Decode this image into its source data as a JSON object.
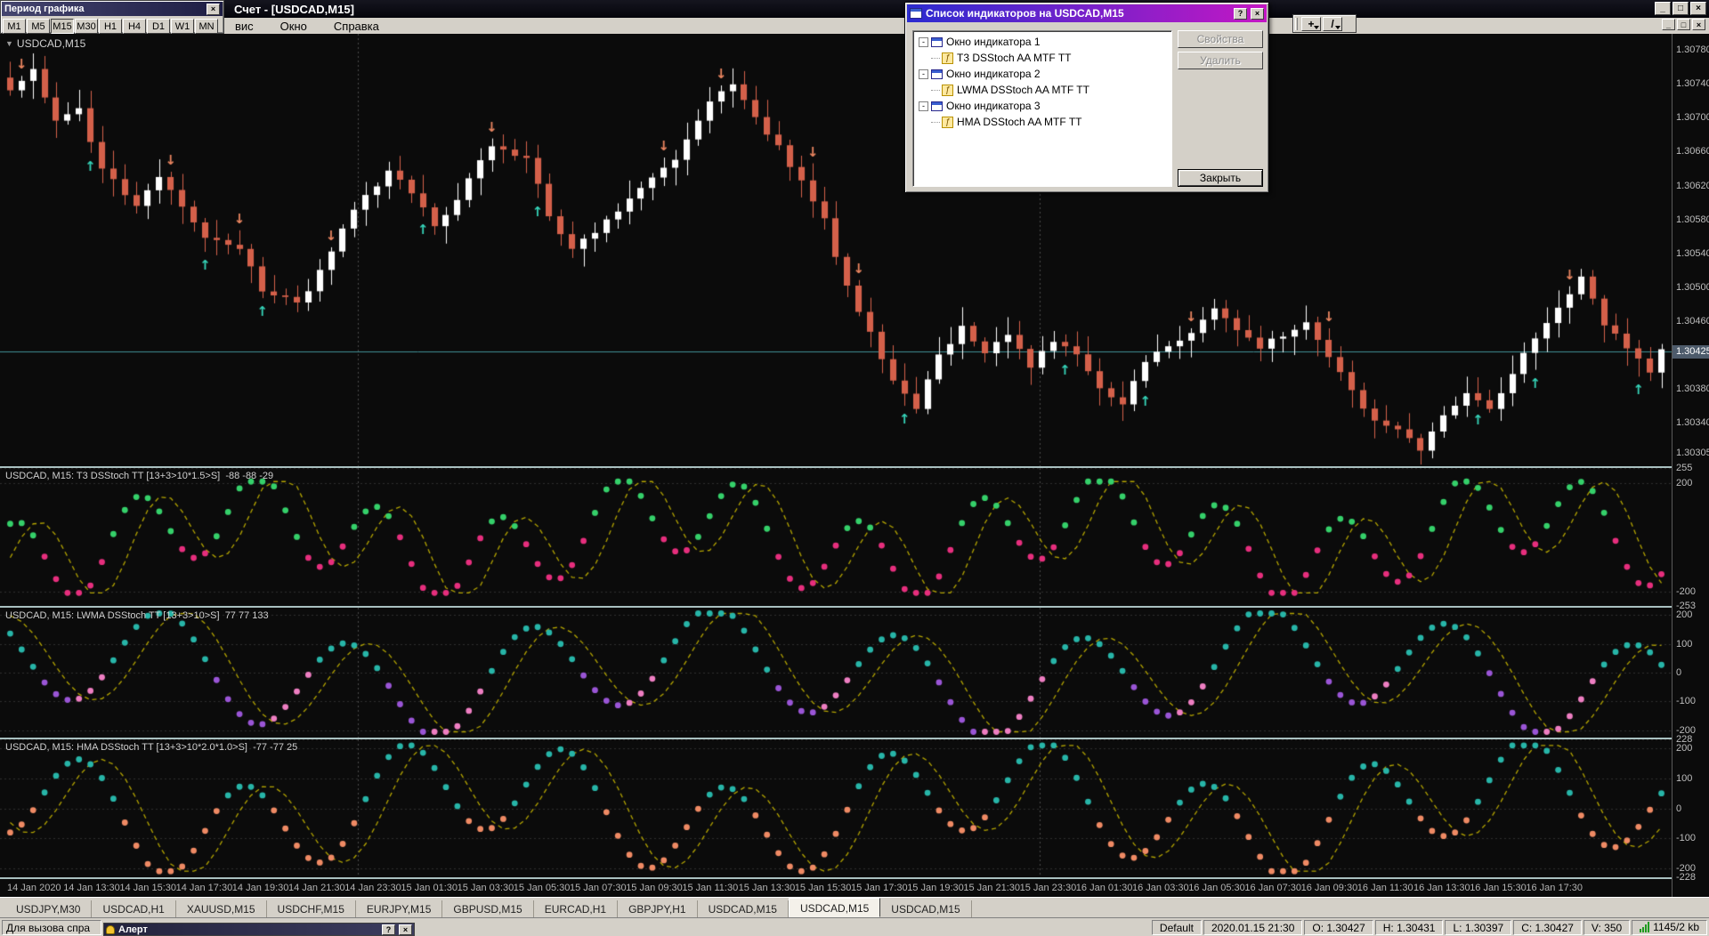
{
  "window": {
    "app_title": "Счет - [USDCAD,M15]",
    "menu": [
      "вис",
      "Окно",
      "Справка"
    ]
  },
  "glyphs": {
    "minimize": "_",
    "maximize": "□",
    "close": "×",
    "help": "?",
    "dropdown": "▼",
    "crosshair": "+",
    "line_tool": "/"
  },
  "period_toolbar": {
    "title": "Период графика",
    "buttons": [
      "M1",
      "M5",
      "M15",
      "M30",
      "H1",
      "H4",
      "D1",
      "W1",
      "MN"
    ],
    "active": "M15"
  },
  "dialog": {
    "title": "Список индикаторов на USDCAD,M15",
    "tree": [
      {
        "type": "window",
        "label": "Окно индикатора 1"
      },
      {
        "type": "indicator",
        "label": "T3 DSStoch AA MTF TT"
      },
      {
        "type": "window",
        "label": "Окно индикатора 2"
      },
      {
        "type": "indicator",
        "label": "LWMA DSStoch AA MTF TT"
      },
      {
        "type": "window",
        "label": "Окно индикатора 3"
      },
      {
        "type": "indicator",
        "label": "HMA DSStoch AA MTF TT"
      }
    ],
    "buttons": {
      "properties": "Свойства",
      "delete": "Удалить",
      "close": "Закрыть"
    }
  },
  "main_chart": {
    "label": "USDCAD,M15",
    "bars": 145,
    "range": [
      1.3029,
      1.308
    ],
    "price_axis": [
      "1.30780",
      "1.30740",
      "1.30700",
      "1.30660",
      "1.30620",
      "1.30580",
      "1.30540",
      "1.30500",
      "1.30460",
      "1.30380",
      "1.30340",
      "1.30305"
    ],
    "current_price": "1.30425",
    "current_price_value": 1.30425,
    "separators_frac": [
      0.214,
      0.622
    ],
    "waypoints": [
      [
        0,
        1.3073
      ],
      [
        2,
        1.30755
      ],
      [
        4,
        1.307
      ],
      [
        6,
        1.30712
      ],
      [
        8,
        1.3064
      ],
      [
        11,
        1.306
      ],
      [
        13,
        1.3063
      ],
      [
        15,
        1.306
      ],
      [
        17,
        1.3056
      ],
      [
        20,
        1.30545
      ],
      [
        22,
        1.305
      ],
      [
        25,
        1.3048
      ],
      [
        27,
        1.3052
      ],
      [
        30,
        1.3059
      ],
      [
        33,
        1.3064
      ],
      [
        35,
        1.30615
      ],
      [
        37,
        1.30575
      ],
      [
        39,
        1.30605
      ],
      [
        42,
        1.3067
      ],
      [
        45,
        1.30655
      ],
      [
        47,
        1.30585
      ],
      [
        49,
        1.30545
      ],
      [
        52,
        1.3058
      ],
      [
        55,
        1.3062
      ],
      [
        58,
        1.30655
      ],
      [
        61,
        1.3072
      ],
      [
        63,
        1.3074
      ],
      [
        65,
        1.307
      ],
      [
        67,
        1.30665
      ],
      [
        69,
        1.30625
      ],
      [
        71,
        1.3058
      ],
      [
        73,
        1.305
      ],
      [
        75,
        1.3045
      ],
      [
        77,
        1.3039
      ],
      [
        79,
        1.3036
      ],
      [
        81,
        1.3042
      ],
      [
        83,
        1.30455
      ],
      [
        85,
        1.30425
      ],
      [
        87,
        1.30445
      ],
      [
        89,
        1.3041
      ],
      [
        91,
        1.30435
      ],
      [
        93,
        1.3042
      ],
      [
        95,
        1.3038
      ],
      [
        97,
        1.3036
      ],
      [
        99,
        1.30415
      ],
      [
        101,
        1.30435
      ],
      [
        103,
        1.30445
      ],
      [
        105,
        1.3048
      ],
      [
        107,
        1.3045
      ],
      [
        109,
        1.3043
      ],
      [
        111,
        1.30445
      ],
      [
        113,
        1.3046
      ],
      [
        115,
        1.3042
      ],
      [
        117,
        1.3038
      ],
      [
        119,
        1.3034
      ],
      [
        121,
        1.3033
      ],
      [
        123,
        1.3031
      ],
      [
        125,
        1.3035
      ],
      [
        127,
        1.3038
      ],
      [
        129,
        1.3036
      ],
      [
        131,
        1.304
      ],
      [
        133,
        1.3044
      ],
      [
        135,
        1.3048
      ],
      [
        137,
        1.3051
      ],
      [
        139,
        1.3046
      ],
      [
        141,
        1.3043
      ],
      [
        143,
        1.304
      ],
      [
        144,
        1.30425
      ]
    ],
    "arrows_up": [
      7,
      17,
      22,
      36,
      46,
      78,
      92,
      99,
      128,
      133,
      142
    ],
    "arrows_down": [
      1,
      14,
      20,
      28,
      42,
      57,
      62,
      70,
      74,
      103,
      115,
      136
    ]
  },
  "panes": [
    {
      "header": "USDCAD, M15: T3 DSStoch TT [13+3>10*1.5>S]  -88 -88 -29",
      "scale": [
        "255",
        "200",
        "-200",
        "-253"
      ],
      "range": [
        -253,
        255
      ],
      "clip": 205,
      "waves": [
        {
          "p": 10.5,
          "a": 150,
          "ph": 1.2
        },
        {
          "p": 37,
          "a": 95,
          "ph": 4.4
        }
      ],
      "pos_color": "#35d06a",
      "neg_color": "#e62e7d",
      "neg_color2": "#e62e7d",
      "line_color": "#b3a400"
    },
    {
      "header": "USDCAD, M15: LWMA DSStoch TT [13+3>10>S]  77 77 133",
      "scale": [
        "200",
        "100",
        "0",
        "-100",
        "-200"
      ],
      "range": [
        -225,
        225
      ],
      "clip": 205,
      "waves": [
        {
          "p": 16,
          "a": 165,
          "ph": 2.6
        },
        {
          "p": 53,
          "a": 70,
          "ph": 0.8
        }
      ],
      "pos_color": "#27b5a8",
      "neg_color": "#9a55d6",
      "neg_color2": "#ee7ec2",
      "line_color": "#b3a400"
    },
    {
      "header": "USDCAD, M15: HMA DSStoch TT [13+3>10*2.0*1.0>S]  -77 -77 25",
      "scale": [
        "228",
        "200",
        "100",
        "0",
        "-100",
        "-200",
        "-228"
      ],
      "range": [
        -228,
        228
      ],
      "clip": 208,
      "waves": [
        {
          "p": 14,
          "a": 155,
          "ph": 5.0
        },
        {
          "p": 45,
          "a": 85,
          "ph": 2.2
        }
      ],
      "pos_color": "#27b5a8",
      "neg_color": "#ef8a64",
      "neg_color2": "#ef8a64",
      "line_color": "#b3a400"
    }
  ],
  "time_axis": [
    "14 Jan 2020",
    "14 Jan 13:30",
    "14 Jan 15:30",
    "14 Jan 17:30",
    "14 Jan 19:30",
    "14 Jan 21:30",
    "14 Jan 23:30",
    "15 Jan 01:30",
    "15 Jan 03:30",
    "15 Jan 05:30",
    "15 Jan 07:30",
    "15 Jan 09:30",
    "15 Jan 11:30",
    "15 Jan 13:30",
    "15 Jan 15:30",
    "15 Jan 17:30",
    "15 Jan 19:30",
    "15 Jan 21:30",
    "15 Jan 23:30",
    "16 Jan 01:30",
    "16 Jan 03:30",
    "16 Jan 05:30",
    "16 Jan 07:30",
    "16 Jan 09:30",
    "16 Jan 11:30",
    "16 Jan 13:30",
    "16 Jan 15:30",
    "16 Jan 17:30"
  ],
  "tabs": {
    "items": [
      "USDJPY,M30",
      "USDCAD,H1",
      "XAUUSD,M15",
      "USDCHF,M15",
      "EURJPY,M15",
      "GBPUSD,M15",
      "EURCAD,H1",
      "GBPJPY,H1",
      "USDCAD,M15",
      "USDCAD,M15",
      "USDCAD,M15"
    ],
    "active_index": 9
  },
  "status": {
    "left": "Для вызова спра",
    "segments": [
      "Default",
      "2020.01.15 21:30",
      "O: 1.30427",
      "H: 1.30431",
      "L: 1.30397",
      "C: 1.30427",
      "V: 350"
    ],
    "connection": "1145/2 kb"
  },
  "alert": {
    "title": "Алерт"
  },
  "colors": {
    "chart_bg": "#0b0b0b",
    "bull": "#ffffff",
    "bear": "#d4604a",
    "arrow_up": "#35d3b8",
    "arrow_down": "#e8845f",
    "price_line": "#3f8f96",
    "grid_dot": "#4a4a4a",
    "level_dot": "#2e2e2e"
  }
}
